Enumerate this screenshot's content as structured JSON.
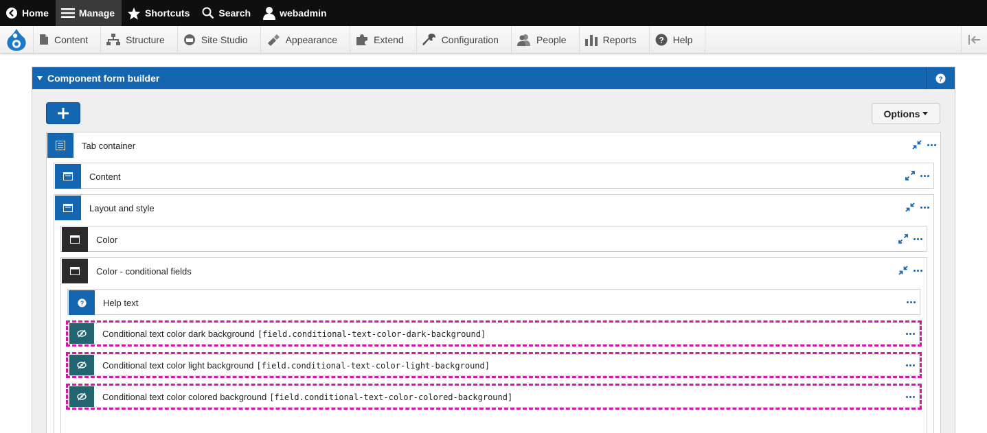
{
  "toolbar": {
    "home": "Home",
    "manage": "Manage",
    "shortcuts": "Shortcuts",
    "search": "Search",
    "user": "webadmin"
  },
  "tray": {
    "items": [
      "Content",
      "Structure",
      "Site Studio",
      "Appearance",
      "Extend",
      "Configuration",
      "People",
      "Reports",
      "Help"
    ]
  },
  "panel": {
    "title": "Component form builder",
    "options_label": "Options"
  },
  "tree": {
    "tab_container": "Tab container",
    "content": "Content",
    "layout_style": "Layout and style",
    "color": "Color",
    "color_conditional": "Color - conditional fields",
    "help_text": "Help text",
    "fields": [
      {
        "label": "Conditional text color dark background",
        "key": "[field.conditional-text-color-dark-background]"
      },
      {
        "label": "Conditional text color light background",
        "key": "[field.conditional-text-color-light-background]"
      },
      {
        "label": "Conditional text color colored background",
        "key": "[field.conditional-text-color-colored-background]"
      }
    ]
  },
  "colors": {
    "brand_blue": "#1566b0",
    "toolbar_black": "#0f0f0f",
    "highlight_magenta": "#d11aa8",
    "teal": "#226470"
  }
}
